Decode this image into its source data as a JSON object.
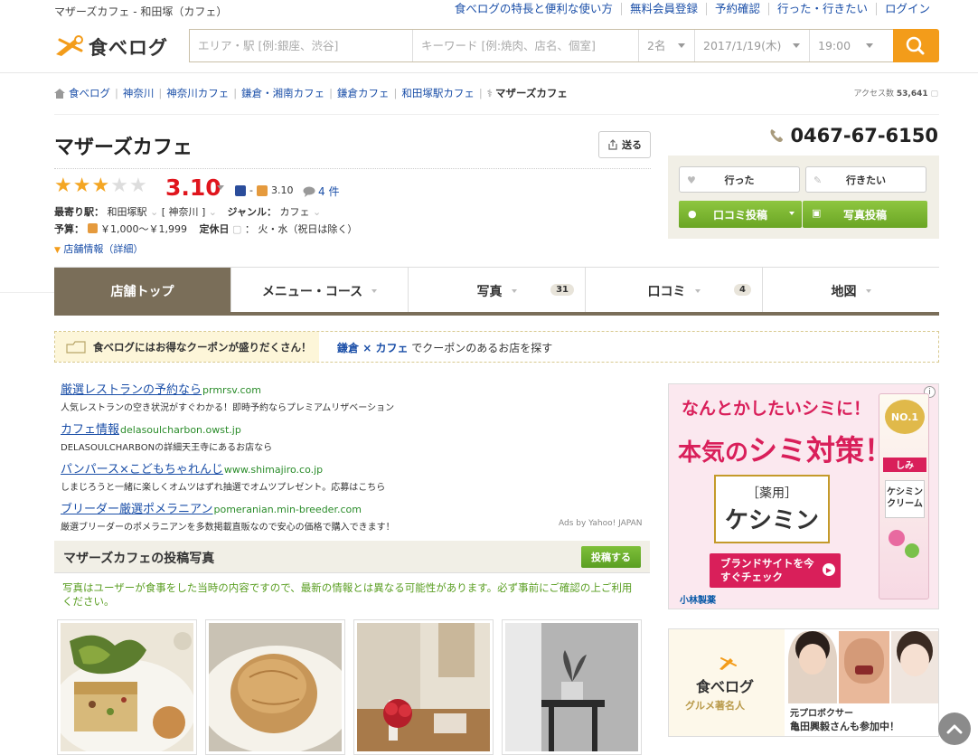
{
  "top": {
    "site_title": "マザーズカフェ - 和田塚（カフェ）",
    "links": [
      "食べログの特長と便利な使い方",
      "無料会員登録",
      "予約確認",
      "行った・行きたい",
      "ログイン"
    ]
  },
  "logo": {
    "text": "食べログ"
  },
  "search": {
    "area_placeholder": "エリア・駅 [例:銀座、渋谷]",
    "keyword_placeholder": "キーワード [例:焼肉、店名、個室]",
    "people": "2名",
    "date": "2017/1/19(木)",
    "time": "19:00"
  },
  "breadcrumb": {
    "items": [
      "食べログ",
      "神奈川",
      "神奈川カフェ",
      "鎌倉・湘南カフェ",
      "鎌倉カフェ",
      "和田塚駅カフェ"
    ],
    "current": "マザーズカフェ"
  },
  "access": {
    "label": "アクセス数",
    "value": "53,641"
  },
  "shop": {
    "name": "マザーズカフェ",
    "send_label": "送る",
    "phone": "0467-67-6150",
    "rating": "3.10",
    "stars_filled": 3,
    "stars_total": 5,
    "dinner_rating": "-",
    "lunch_rating": "3.10",
    "review_count": "4 件",
    "station_label": "最寄り駅：",
    "station": "和田塚駅",
    "prefecture": "[ 神奈川 ]",
    "genre_label": "ジャンル：",
    "genre": "カフェ",
    "budget_label": "予算：",
    "budget": "￥1,000～￥1,999",
    "closed_label": "定休日",
    "closed": "火・水（祝日は除く）",
    "detail_link": "店舗情報（詳細）"
  },
  "actions": {
    "went": "行った",
    "want": "行きたい",
    "post_review": "口コミ投稿",
    "post_photo": "写真投稿"
  },
  "tabs": [
    {
      "label": "店舗トップ",
      "badge": ""
    },
    {
      "label": "メニュー・コース",
      "badge": ""
    },
    {
      "label": "写真",
      "badge": "31"
    },
    {
      "label": "口コミ",
      "badge": "4"
    },
    {
      "label": "地図",
      "badge": ""
    }
  ],
  "coupon": {
    "left": "食べログにはお得なクーポンが盛りだくさん！",
    "right_a": "鎌倉",
    "right_x": " × ",
    "right_b": "カフェ",
    "right_rest": " でクーポンのあるお店を探す"
  },
  "ads": [
    {
      "title": "厳選レストランの予約なら",
      "url": "prmrsv.com",
      "desc": "人気レストランの空き状況がすぐわかる！即時予約ならプレミアムリザベーション"
    },
    {
      "title": "カフェ情報",
      "url": "delasoulcharbon.owst.jp",
      "desc": "DELASOULCHARBONの詳細天王寺にあるお店なら"
    },
    {
      "title": "パンパース×こどもちゃれんじ",
      "url": "www.shimajiro.co.jp",
      "desc": "しまじろうと一緒に楽しくオムツはずれ抽選でオムツプレゼント。応募はこちら"
    },
    {
      "title": "ブリーダー厳選ポメラニアン",
      "url": "pomeranian.min-breeder.com",
      "desc": "厳選ブリーダーのポメラニアンを多数掲載直販なので安心の価格で購入できます！"
    }
  ],
  "ads_by": "Ads by Yahoo! JAPAN",
  "photos": {
    "title": "マザーズカフェの投稿写真",
    "post_button": "投稿する",
    "note": "写真はユーザーが食事をした当時の内容ですので、最新の情報とは異なる可能性があります。必ず事前にご確認の上ご利用ください。"
  },
  "banner1": {
    "line1": "なんとかしたいシミに！",
    "line2a": "本気の",
    "line2b": "シミ対策！",
    "product_small": "［薬用］",
    "product": "ケシミン",
    "cta": "ブランドサイトを今すぐチェック",
    "maker": "小林製薬",
    "badge": "NO.1",
    "box_tag": "しみ",
    "box_name": "ケシミンクリーム"
  },
  "banner2": {
    "logo": "食べログ",
    "sub": "グルメ著名人",
    "caption_small": "元プロボクサー",
    "caption": "亀田興毅さんも参加中！"
  },
  "colors": {
    "accent": "#f39c1a",
    "link": "#1b4fa8",
    "rating": "#e0151d",
    "tab_active": "#7a6e59",
    "green": "#6aa524"
  }
}
